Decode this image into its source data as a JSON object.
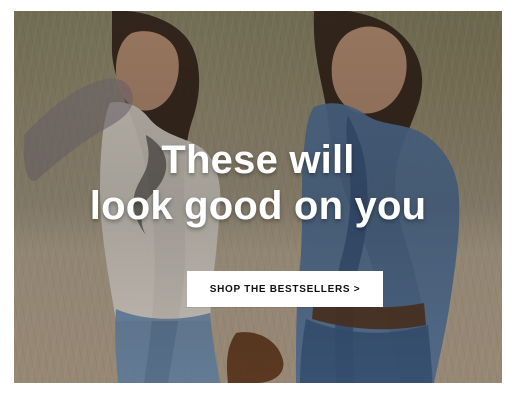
{
  "hero": {
    "headline_line_1": "These will",
    "headline_line_2": "look good on you",
    "cta_label": "SHOP THE BESTSELLERS >"
  }
}
